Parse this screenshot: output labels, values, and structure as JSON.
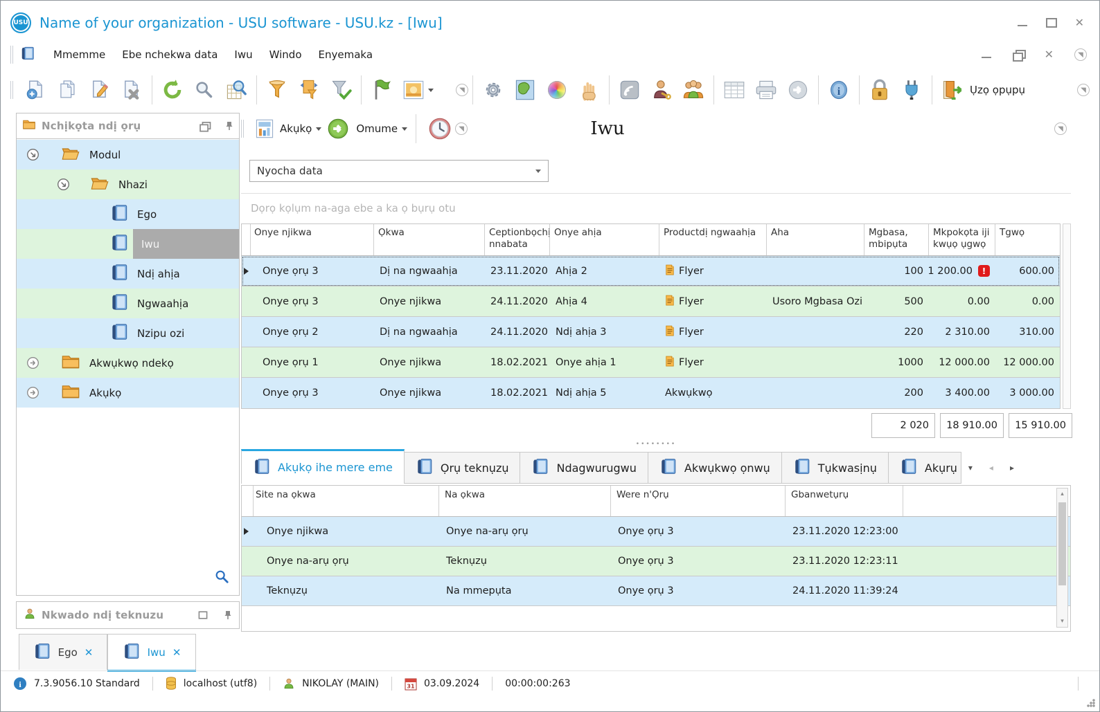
{
  "window": {
    "title": "Name of your organization - USU software - USU.kz - [Iwu]"
  },
  "menu": {
    "items": [
      {
        "label": "Mmemme"
      },
      {
        "label": "Ebe nchekwa data"
      },
      {
        "label": "Iwu"
      },
      {
        "label": "Windo"
      },
      {
        "label": "Enyemaka"
      }
    ]
  },
  "toolbar": {
    "exit_label": "Ụzọ ọpụpụ",
    "icons": [
      "add-record-icon",
      "copy-record-icon",
      "edit-record-icon",
      "delete-record-icon",
      "refresh-icon",
      "search-icon",
      "search-table-icon",
      "filter-icon",
      "filter-range-icon",
      "filter-apply-icon",
      "flag-icon",
      "image-icon",
      "settings-gear-icon",
      "map-icon",
      "color-wheel-icon",
      "hand-icon",
      "feed-icon",
      "user-key-icon",
      "users-icon",
      "table-icon",
      "printer-icon",
      "go-arrow-icon",
      "info-icon",
      "lock-icon",
      "plug-icon",
      "exit-door-icon"
    ]
  },
  "sidebar": {
    "title": "Nchịkọta ndị ọrụ",
    "tree": [
      {
        "label": "Modul"
      },
      {
        "label": "Nhazi"
      },
      {
        "label": "Ego"
      },
      {
        "label": "Iwu"
      },
      {
        "label": "Ndị ahịa"
      },
      {
        "label": "Ngwaahịa"
      },
      {
        "label": "Nzipu ozi"
      },
      {
        "label": "Akwụkwọ ndekọ"
      },
      {
        "label": "Akụkọ"
      }
    ],
    "support_title": "Nkwado ndị teknuzu"
  },
  "view_toolbar": {
    "report": "Akụkọ",
    "action": "Omume",
    "title": "Iwu"
  },
  "filter_combo": {
    "value": "Nyocha data"
  },
  "group_hint": "Dọrọ kọlụm na-aga ebe a ka ọ bụrụ otu",
  "main_table": {
    "columns": [
      "Onye njikwa",
      "Ọkwa",
      "Ceptionbọchị nnabata",
      "Onye ahịa",
      "Productdị ngwaahịa",
      "Aha",
      "Mgbasa, mbipụta",
      "Mkpokọta iji kwụọ ụgwọ",
      "Tgwọ"
    ],
    "rows": [
      {
        "manager": "Onye ọrụ 3",
        "status": "Dị na ngwaahịa",
        "date": "23.11.2020",
        "client": "Ahịa 2",
        "product": "Flyer",
        "name": "",
        "qty": "100",
        "amount": "1 200.00",
        "paid": "600.00"
      },
      {
        "manager": "Onye ọrụ 3",
        "status": "Onye njikwa",
        "date": "24.11.2020",
        "client": "Ahịa 4",
        "product": "Flyer",
        "name": "Usoro Mgbasa Ozi",
        "qty": "500",
        "amount": "0.00",
        "paid": "0.00"
      },
      {
        "manager": "Onye ọrụ 2",
        "status": "Dị na ngwaahịa",
        "date": "24.11.2020",
        "client": "Ndị ahịa 3",
        "product": "Flyer",
        "name": "",
        "qty": "220",
        "amount": "2 310.00",
        "paid": "310.00"
      },
      {
        "manager": "Onye ọrụ 1",
        "status": "Onye njikwa",
        "date": "18.02.2021",
        "client": "Onye ahịa 1",
        "product": "Flyer",
        "name": "",
        "qty": "1000",
        "amount": "12 000.00",
        "paid": "12 000.00"
      },
      {
        "manager": "Onye ọrụ 3",
        "status": "Onye njikwa",
        "date": "18.02.2021",
        "client": "Ndị ahịa 5",
        "product": "Akwụkwọ",
        "name": "",
        "qty": "200",
        "amount": "3 400.00",
        "paid": "3 000.00"
      }
    ],
    "totals": {
      "qty": "2 020",
      "amount": "18 910.00",
      "paid": "15 910.00"
    }
  },
  "bottom_tabs": [
    {
      "label": "Akụkọ ihe mere eme"
    },
    {
      "label": "Ọrụ teknụzụ"
    },
    {
      "label": "Ndagwurugwu"
    },
    {
      "label": "Akwụkwọ ọnwụ"
    },
    {
      "label": "Tụkwasịnụ"
    },
    {
      "label": "Akụrụ"
    }
  ],
  "history_table": {
    "columns": [
      "Site na ọkwa",
      "Na ọkwa",
      "Were n'Ọrụ",
      "Gbanwetụrụ"
    ],
    "rows": [
      {
        "from": "Onye njikwa",
        "to": "Onye na-arụ ọrụ",
        "by": "Onye ọrụ 3",
        "at": "23.11.2020 12:23:00"
      },
      {
        "from": "Onye na-arụ ọrụ",
        "to": "Teknụzụ",
        "by": "Onye ọrụ 3",
        "at": "23.11.2020 12:23:11"
      },
      {
        "from": "Teknụzụ",
        "to": "Na mmepụta",
        "by": "Onye ọrụ 3",
        "at": "24.11.2020 11:39:24"
      }
    ]
  },
  "window_tabs": [
    {
      "label": "Ego"
    },
    {
      "label": "Iwu"
    }
  ],
  "status_bar": {
    "version": "7.3.9056.10 Standard",
    "database": "localhost (utf8)",
    "user": "NIKOLAY (MAIN)",
    "calendar_day": "31",
    "date": "03.09.2024",
    "timer": "00:00:00:263"
  },
  "logo_text": "USU",
  "colors": {
    "accent": "#1b95d2",
    "row_blue": "#d5ebfa",
    "row_green": "#def4dd",
    "selected_gray": "#ababab",
    "warning": "#e01b1b"
  }
}
